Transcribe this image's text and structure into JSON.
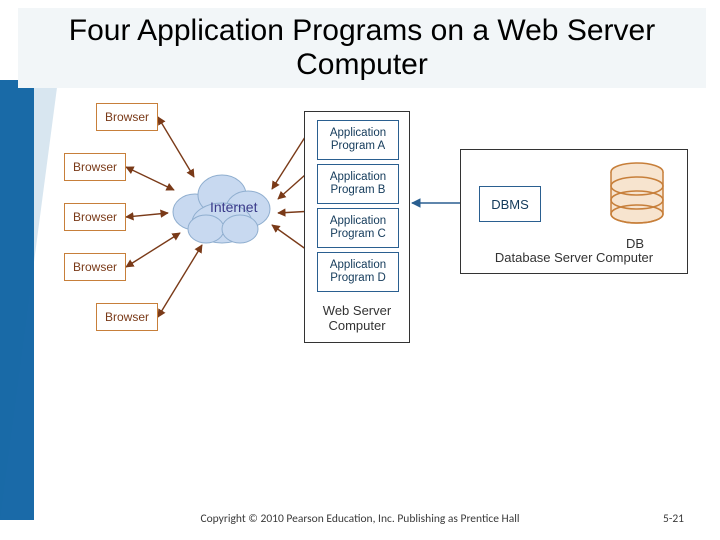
{
  "title": "Four Application Programs on a Web Server Computer",
  "browsers": {
    "b1": "Browser",
    "b2": "Browser",
    "b3": "Browser",
    "b4": "Browser",
    "b5": "Browser"
  },
  "cloud_label": "Internet",
  "web_server": {
    "caption": "Web Server Computer",
    "apps": {
      "a1": "Application Program A",
      "a2": "Application Program B",
      "a3": "Application Program C",
      "a4": "Application Program D"
    }
  },
  "db_server": {
    "caption": "Database Server Computer",
    "dbms": "DBMS",
    "db": "DB"
  },
  "footer": "Copyright © 2010 Pearson Education, Inc. Publishing as Prentice Hall",
  "pagenum": "5-21"
}
